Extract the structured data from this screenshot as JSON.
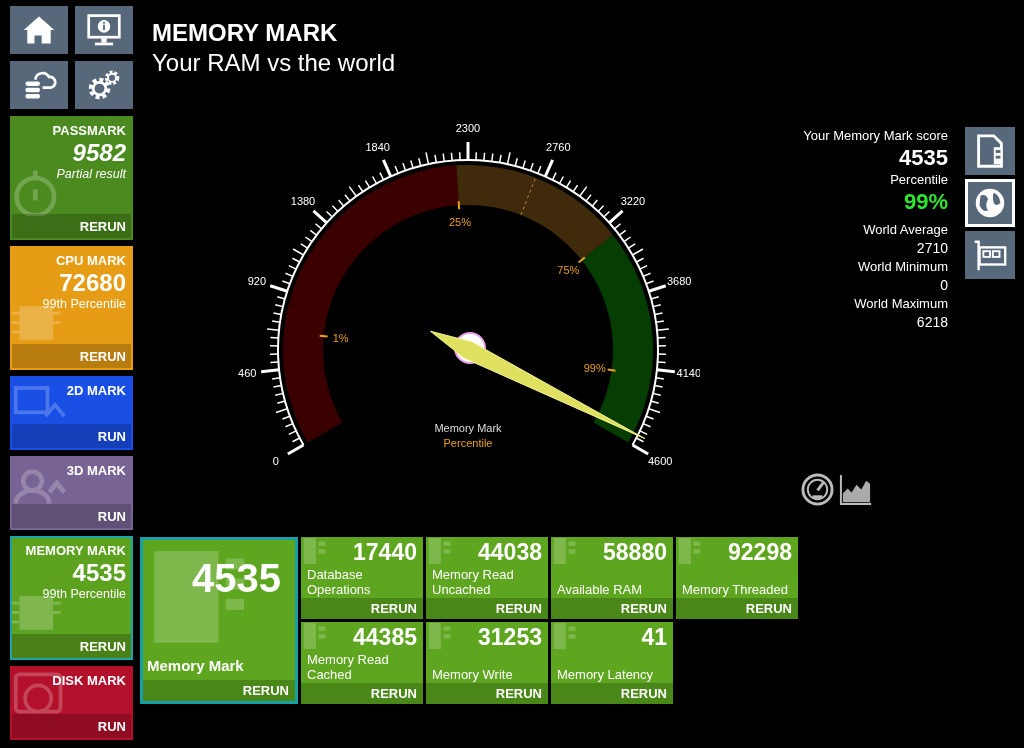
{
  "header": {
    "title": "MEMORY MARK",
    "subtitle": "Your RAM vs the world"
  },
  "sidebar": [
    {
      "kind": "stopwatch",
      "title": "PASSMARK",
      "value": "9582",
      "subtitle": "Partial result",
      "action": "RERUN",
      "color": "#4b8a1f",
      "selected": false
    },
    {
      "kind": "chip",
      "title": "CPU MARK",
      "value": "72680",
      "subtitle": "99th Percentile",
      "action": "RERUN",
      "color": "#e69c14",
      "selected": false
    },
    {
      "kind": "monitor",
      "title": "2D MARK",
      "action": "RUN",
      "color": "#1a4fe6",
      "selected": false
    },
    {
      "kind": "people",
      "title": "3D MARK",
      "action": "RUN",
      "color": "#786494",
      "selected": false
    },
    {
      "kind": "chip",
      "title": "MEMORY MARK",
      "value": "4535",
      "subtitle": "99th Percentile",
      "action": "RERUN",
      "color": "#5ca21f",
      "selected": true
    },
    {
      "kind": "disk",
      "title": "DISK MARK",
      "action": "RUN",
      "color": "#b3102b",
      "selected": false
    }
  ],
  "gauge": {
    "tick_labels": [
      "0",
      "460",
      "920",
      "1380",
      "1840",
      "2300",
      "2760",
      "3220",
      "3680",
      "4140",
      "4600"
    ],
    "percentile_labels": [
      "1%",
      "25%",
      "75%",
      "99%"
    ],
    "caption": "Memory Mark",
    "caption_sub": "Percentile"
  },
  "summary": {
    "score_label": "Your Memory Mark score",
    "score": "4535",
    "percentile_label": "Percentile",
    "percentile": "99%",
    "stats": [
      {
        "label": "World Average",
        "value": "2710"
      },
      {
        "label": "World Minimum",
        "value": "0"
      },
      {
        "label": "World Maximum",
        "value": "6218"
      }
    ]
  },
  "view_buttons": [
    {
      "kind": "document",
      "selected": false
    },
    {
      "kind": "globe",
      "selected": true
    },
    {
      "kind": "card",
      "selected": false
    }
  ],
  "results": {
    "main": {
      "value": "4535",
      "label": "Memory Mark",
      "action": "RERUN",
      "selected": true
    },
    "tests": [
      {
        "value": "17440",
        "label": "Database Operations",
        "action": "RERUN"
      },
      {
        "value": "44038",
        "label": "Memory Read Uncached",
        "action": "RERUN"
      },
      {
        "value": "58880",
        "label": "Available RAM",
        "action": "RERUN"
      },
      {
        "value": "92298",
        "label": "Memory Threaded",
        "action": "RERUN"
      },
      {
        "value": "44385",
        "label": "Memory Read Cached",
        "action": "RERUN"
      },
      {
        "value": "31253",
        "label": "Memory Write",
        "action": "RERUN"
      },
      {
        "value": "41",
        "label": "Memory Latency",
        "action": "RERUN"
      }
    ]
  }
}
